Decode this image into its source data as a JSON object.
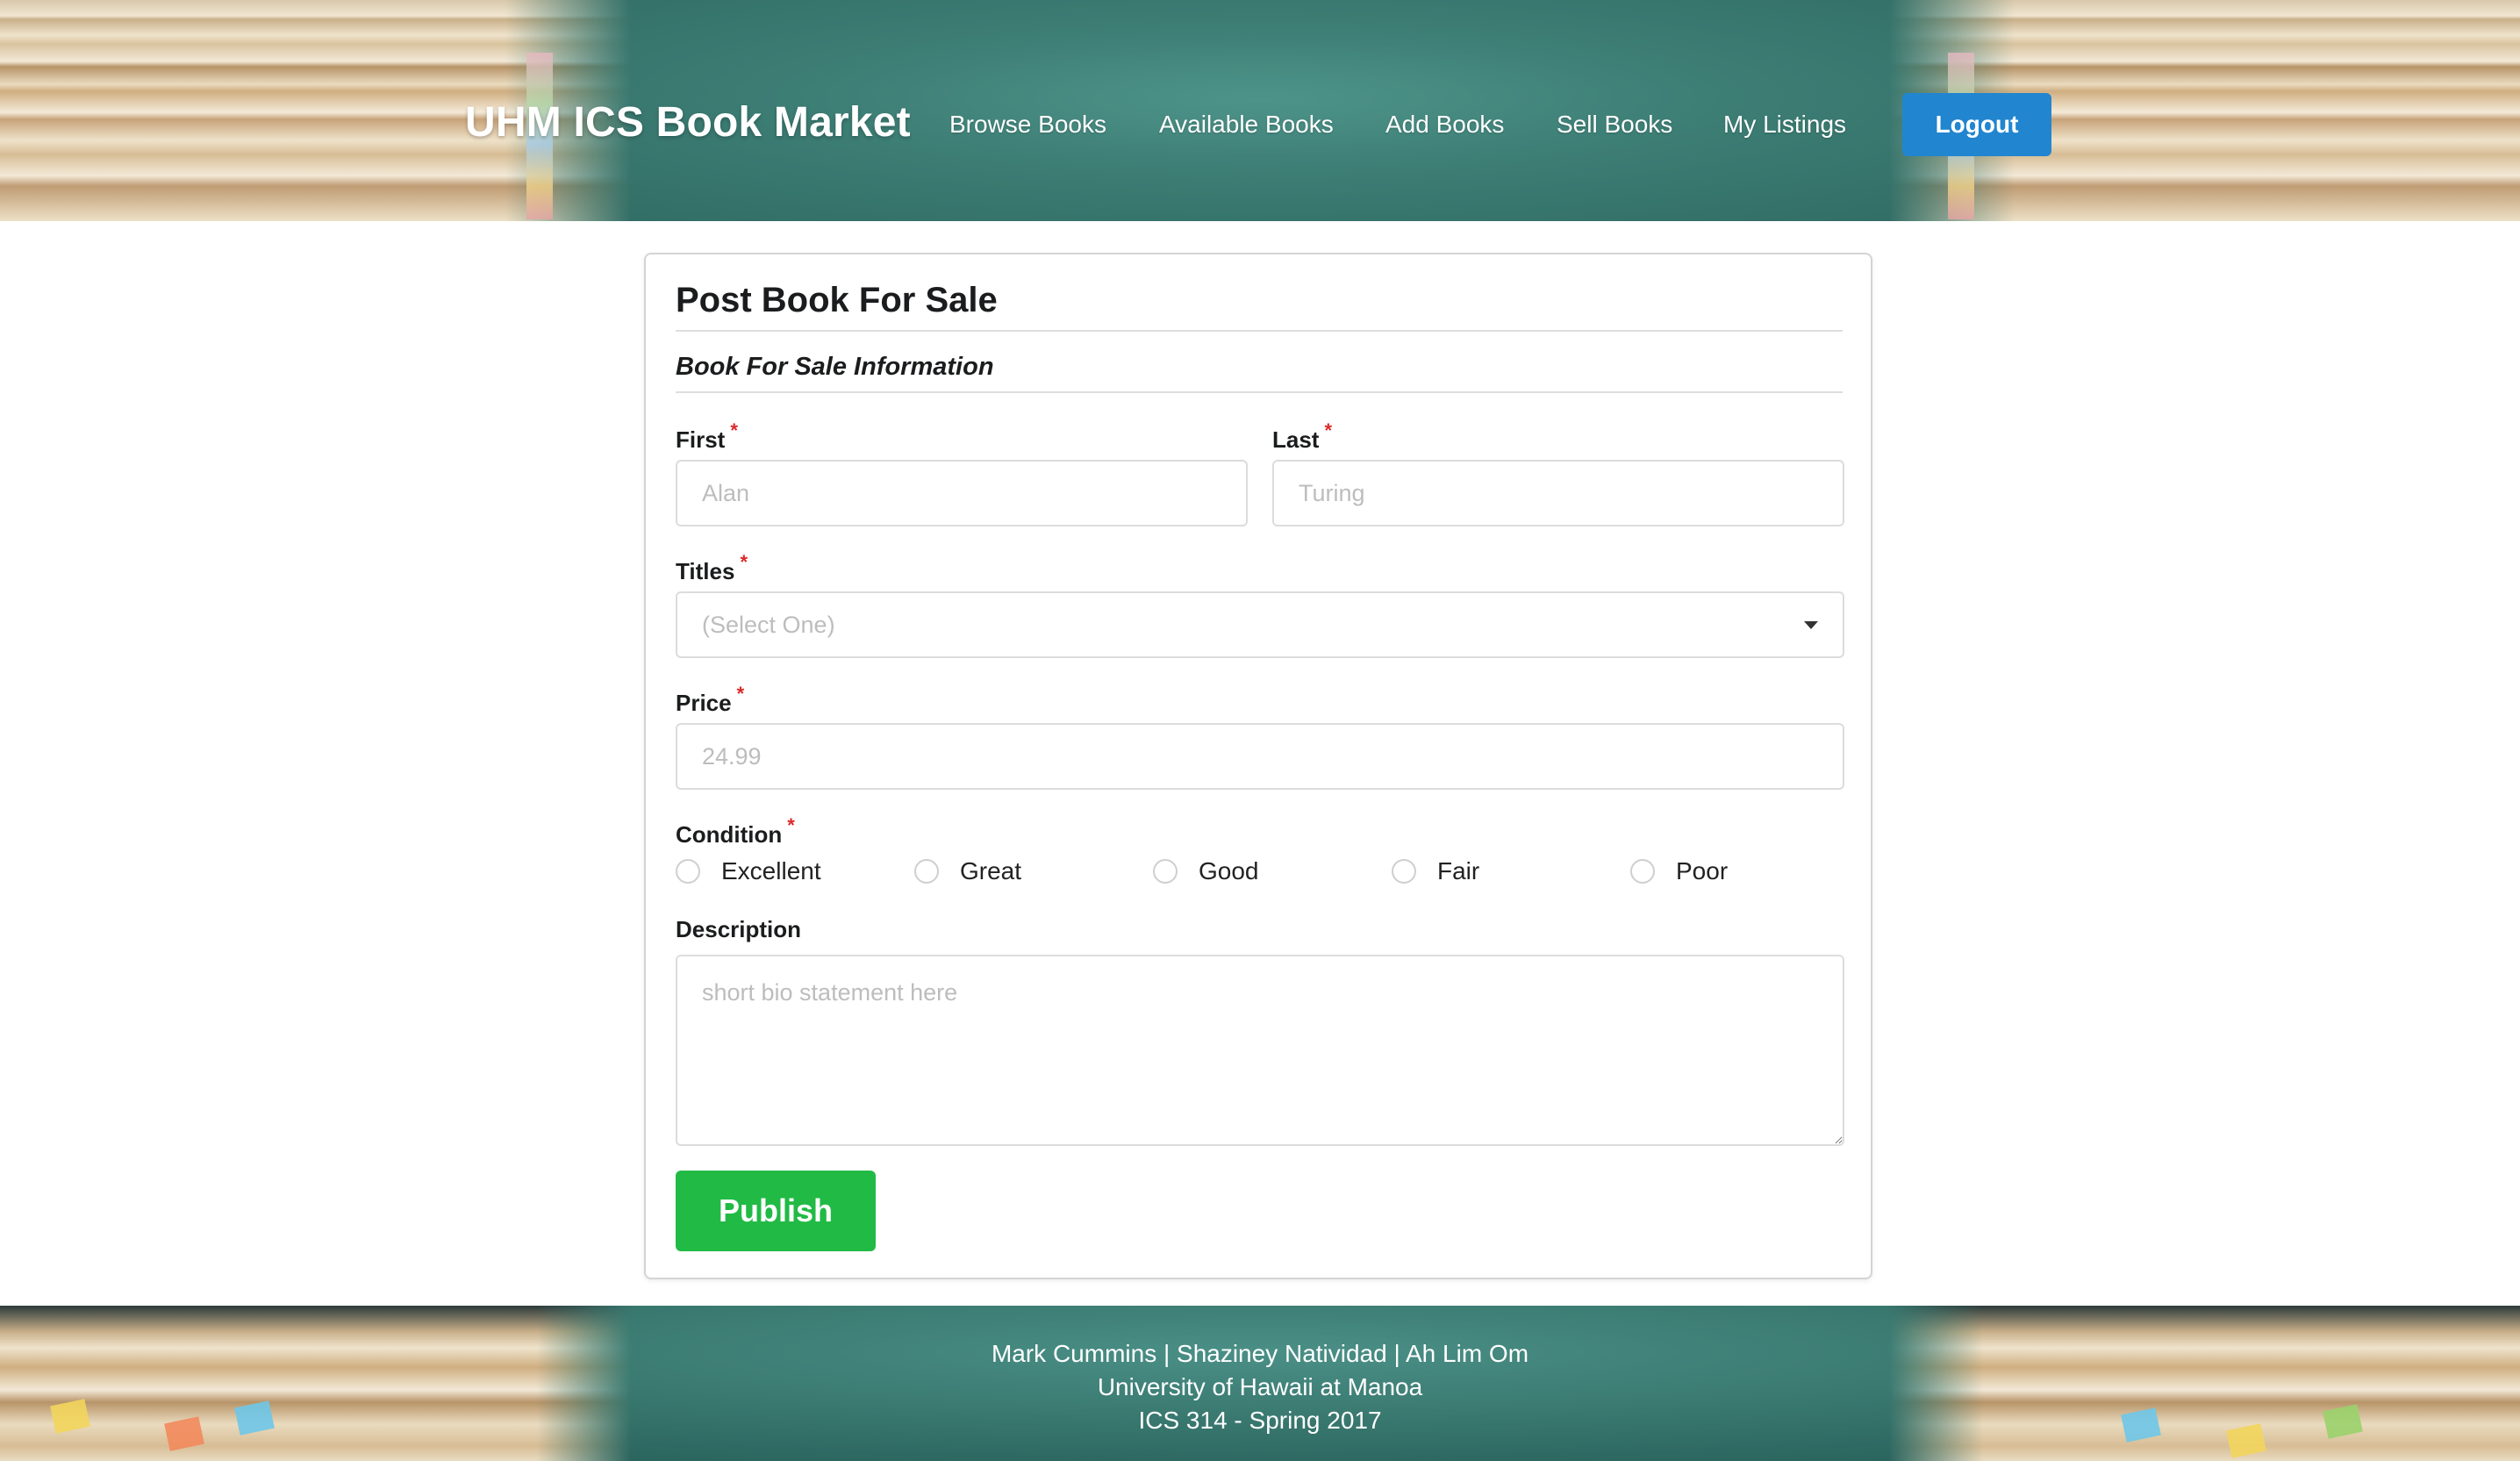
{
  "header": {
    "brand": "UHM ICS Book Market",
    "nav": [
      {
        "label": "Browse Books"
      },
      {
        "label": "Available Books"
      },
      {
        "label": "Add Books"
      },
      {
        "label": "Sell Books"
      },
      {
        "label": "My Listings"
      }
    ],
    "logout_label": "Logout"
  },
  "form": {
    "title": "Post Book For Sale",
    "section_title": "Book For Sale Information",
    "first": {
      "label": "First",
      "placeholder": "Alan",
      "value": ""
    },
    "last": {
      "label": "Last",
      "placeholder": "Turing",
      "value": ""
    },
    "titles": {
      "label": "Titles",
      "selected": "(Select One)"
    },
    "price": {
      "label": "Price",
      "placeholder": "24.99",
      "value": ""
    },
    "condition": {
      "label": "Condition",
      "options": [
        {
          "label": "Excellent",
          "checked": false
        },
        {
          "label": "Great",
          "checked": false
        },
        {
          "label": "Good",
          "checked": false
        },
        {
          "label": "Fair",
          "checked": false
        },
        {
          "label": "Poor",
          "checked": false
        }
      ]
    },
    "description": {
      "label": "Description",
      "placeholder": "short bio statement here",
      "value": ""
    },
    "required_mark": "*",
    "publish_label": "Publish"
  },
  "footer": {
    "authors": "Mark Cummins | Shaziney Natividad | Ah Lim Om",
    "school": "University of Hawaii at Manoa",
    "course": "ICS 314 - Spring 2017"
  },
  "colors": {
    "primary_blue": "#2185d0",
    "publish_green": "#21ba45",
    "required_red": "#db2828",
    "chalkboard": "#3b7a72"
  }
}
